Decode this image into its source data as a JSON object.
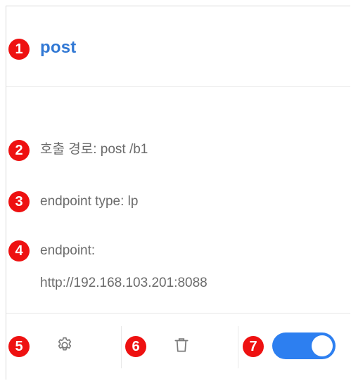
{
  "card": {
    "title": "post",
    "fields": {
      "call_path": "호출 경로: post /b1",
      "endpoint_type": "endpoint type: lp",
      "endpoint_label": "endpoint:",
      "endpoint_value": "http://192.168.103.201:8088"
    },
    "footer": {
      "settings_icon": "gear-icon",
      "delete_icon": "trash-icon",
      "toggle_state": "on"
    }
  },
  "badges": [
    "1",
    "2",
    "3",
    "4",
    "5",
    "6",
    "7"
  ],
  "colors": {
    "title": "#3178d4",
    "text": "#6b6b6b",
    "badge": "#ee1111",
    "toggle_on": "#2d7ff0",
    "border": "#e8e8e8"
  }
}
